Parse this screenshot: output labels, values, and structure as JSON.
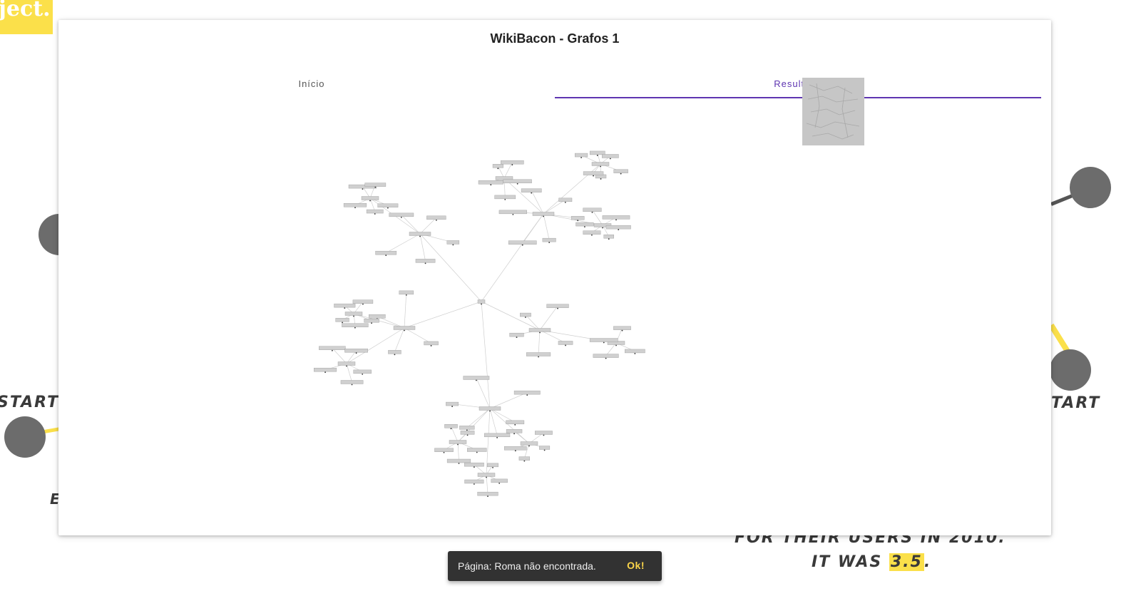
{
  "background": {
    "logo_fragment": "ject.",
    "start_left": "START",
    "start_right": "TART",
    "letter_left": "E",
    "caption_line1": "FOR THEIR USERS IN 2010.",
    "caption_line2_prefix": "IT WAS ",
    "caption_highlight": "3.5",
    "caption_line2_suffix": ".",
    "colors": {
      "accent_yellow": "#fbe04a",
      "node_gray": "#6c6c6c"
    }
  },
  "dialog": {
    "title": "WikiBacon - Grafos 1",
    "tabs": [
      {
        "label": "Início",
        "active": false
      },
      {
        "label": "Resultado",
        "active": true
      }
    ],
    "accent_color": "#5e35b1",
    "thumbnail_icon": "graph-thumbnail-image"
  },
  "snackbar": {
    "message": "Página: Roma não encontrada.",
    "action_label": "Ok!"
  }
}
